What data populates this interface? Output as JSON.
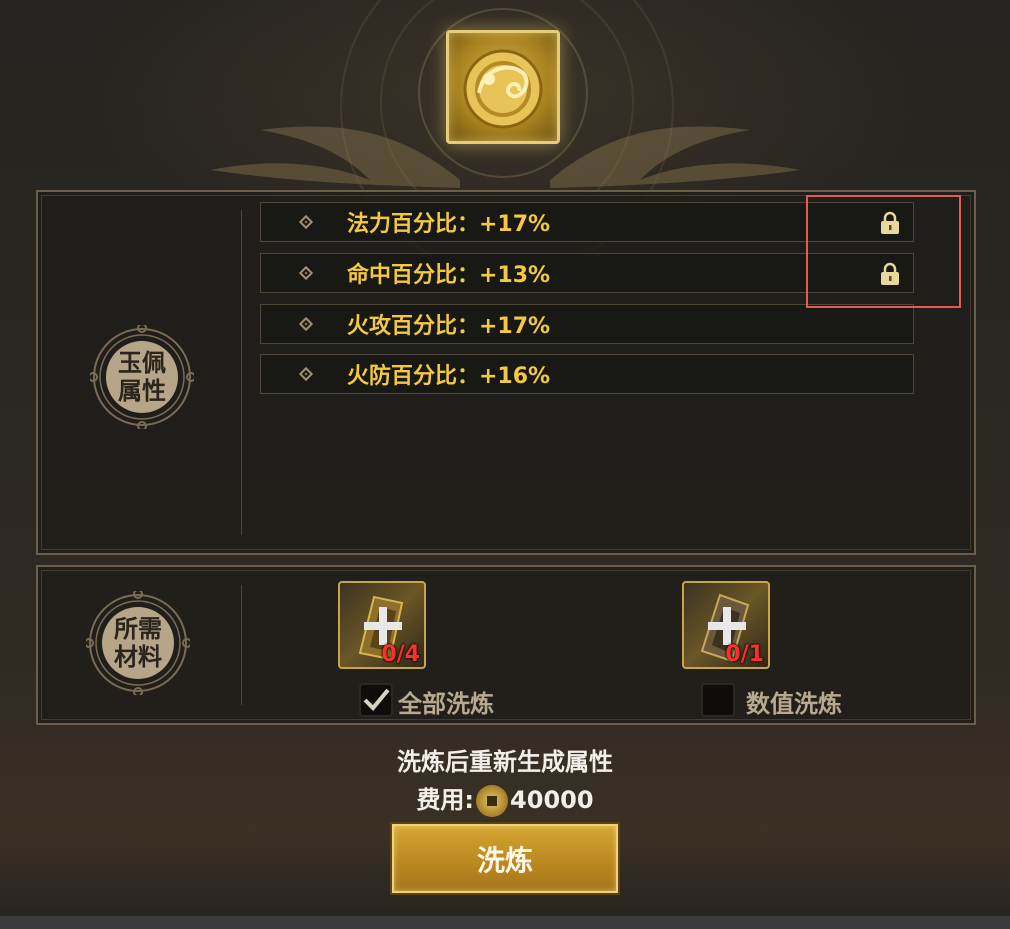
{
  "item": {
    "icon": "jade-pendant-icon"
  },
  "attributes_panel": {
    "seal_label": "玉佩属性",
    "rows": [
      {
        "text": "法力百分比：+17%",
        "locked": true
      },
      {
        "text": "命中百分比：+13%",
        "locked": true
      },
      {
        "text": "火攻百分比：+17%",
        "locked": false
      },
      {
        "text": "火防百分比：+16%",
        "locked": false
      }
    ]
  },
  "materials_panel": {
    "seal_label": "所需材料",
    "slots": [
      {
        "count": "0/4",
        "option_label": "全部洗炼",
        "checked": true
      },
      {
        "count": "0/1",
        "option_label": "数值洗炼",
        "checked": false
      }
    ]
  },
  "info": {
    "description": "洗炼后重新生成属性",
    "cost_label": "费用:",
    "cost_value": "40000"
  },
  "action": {
    "wash_label": "洗炼"
  },
  "colors": {
    "attribute_text": "#f3c843",
    "count_text": "#ff2f2f",
    "highlight": "#e55a55"
  }
}
